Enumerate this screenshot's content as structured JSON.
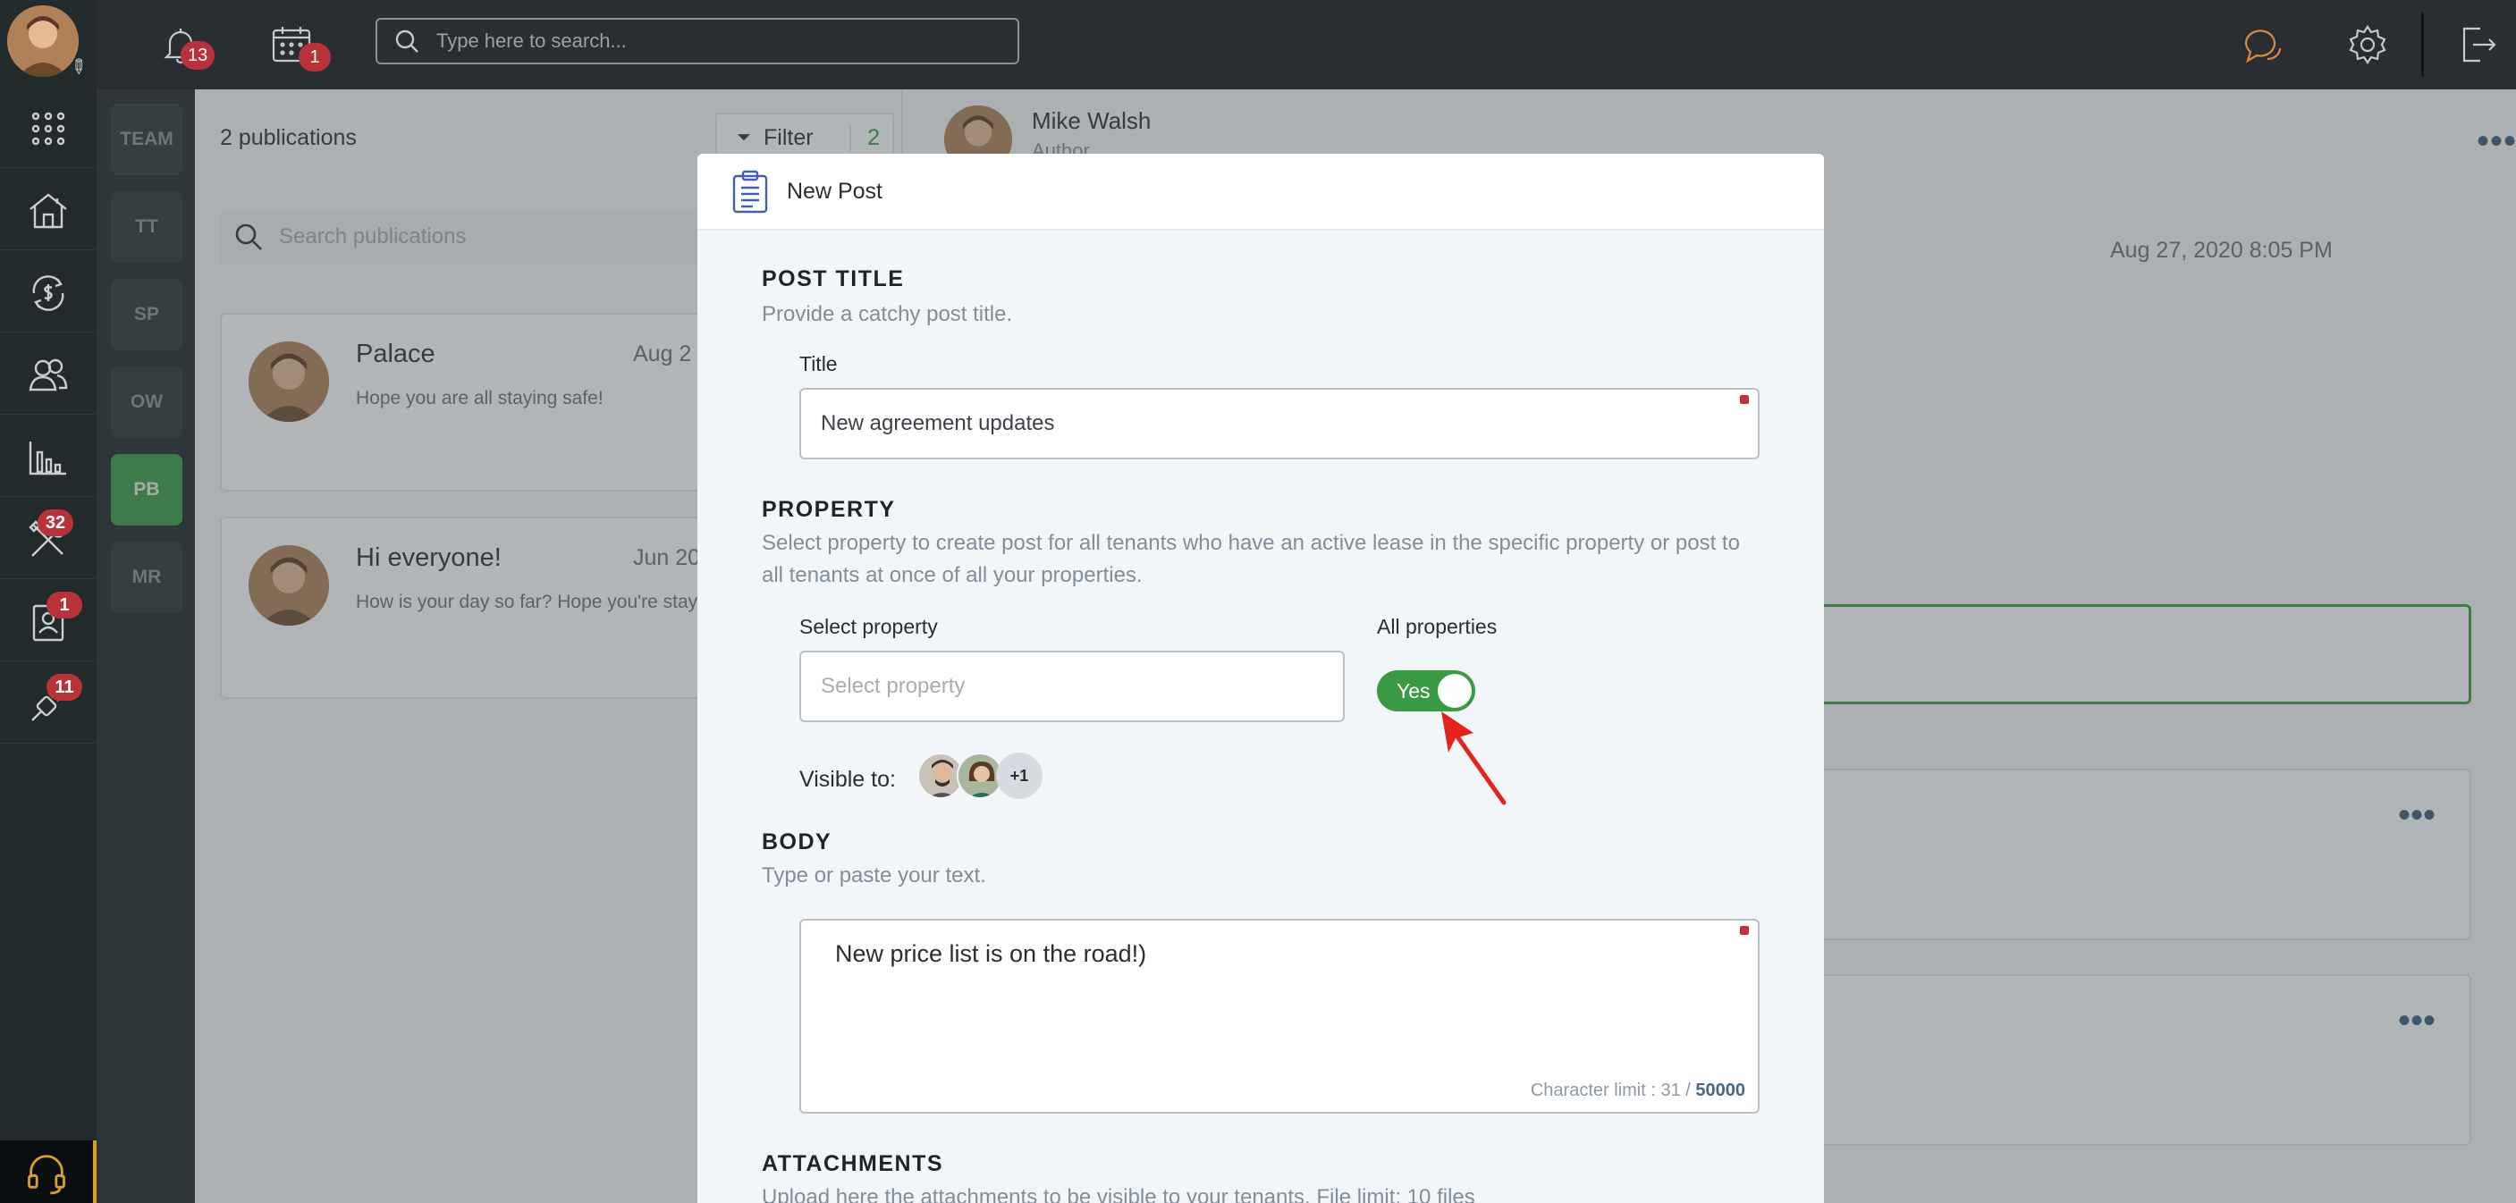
{
  "topbar": {
    "notifications_count": "13",
    "calendar_count": "1",
    "search_placeholder": "Type here to search..."
  },
  "rail": {
    "badges": {
      "maintenance": "32",
      "applications": "1",
      "tools": "11"
    }
  },
  "teams": [
    "TEAM",
    "TT",
    "SP",
    "OW",
    "PB",
    "MR"
  ],
  "publications": {
    "count_label": "2 publications",
    "filter_label": "Filter",
    "filter_count": "2",
    "search_placeholder": "Search publications",
    "items": [
      {
        "title": "Palace",
        "date": "Aug 2",
        "preview": "Hope you are all staying safe!"
      },
      {
        "title": "Hi everyone!",
        "date": "Jun 20",
        "preview": "How is your day so far? Hope you're stay"
      }
    ]
  },
  "detail": {
    "author_name": "Mike Walsh",
    "author_role": "Author",
    "date": "Aug 27, 2020 8:05 PM",
    "more": "•••"
  },
  "modal": {
    "title": "New Post",
    "post_title": {
      "heading": "POST TITLE",
      "subtitle": "Provide a catchy post title.",
      "field_label": "Title",
      "value": "New agreement updates"
    },
    "property": {
      "heading": "PROPERTY",
      "subtitle": "Select property to create post for all tenants who have an active lease in the specific property or post to all tenants at once of all your properties.",
      "select_label": "Select property",
      "select_placeholder": "Select property",
      "all_label": "All properties",
      "toggle_label": "Yes",
      "visible_label": "Visible to:",
      "visible_more": "+1"
    },
    "body": {
      "heading": "BODY",
      "subtitle": "Type or paste your text.",
      "value": "New price list is on the road!)",
      "char_limit_prefix": "Character limit : 31 / ",
      "char_limit_max": "50000"
    },
    "attachments": {
      "heading": "ATTACHMENTS",
      "subtitle": "Upload here the attachments to be visible to your tenants. File limit: 10 files"
    }
  },
  "colors": {
    "accent_green": "#3a9a44",
    "badge_red": "#b9323a",
    "required_red": "#c7313e",
    "annotation_arrow": "#e3231d"
  }
}
